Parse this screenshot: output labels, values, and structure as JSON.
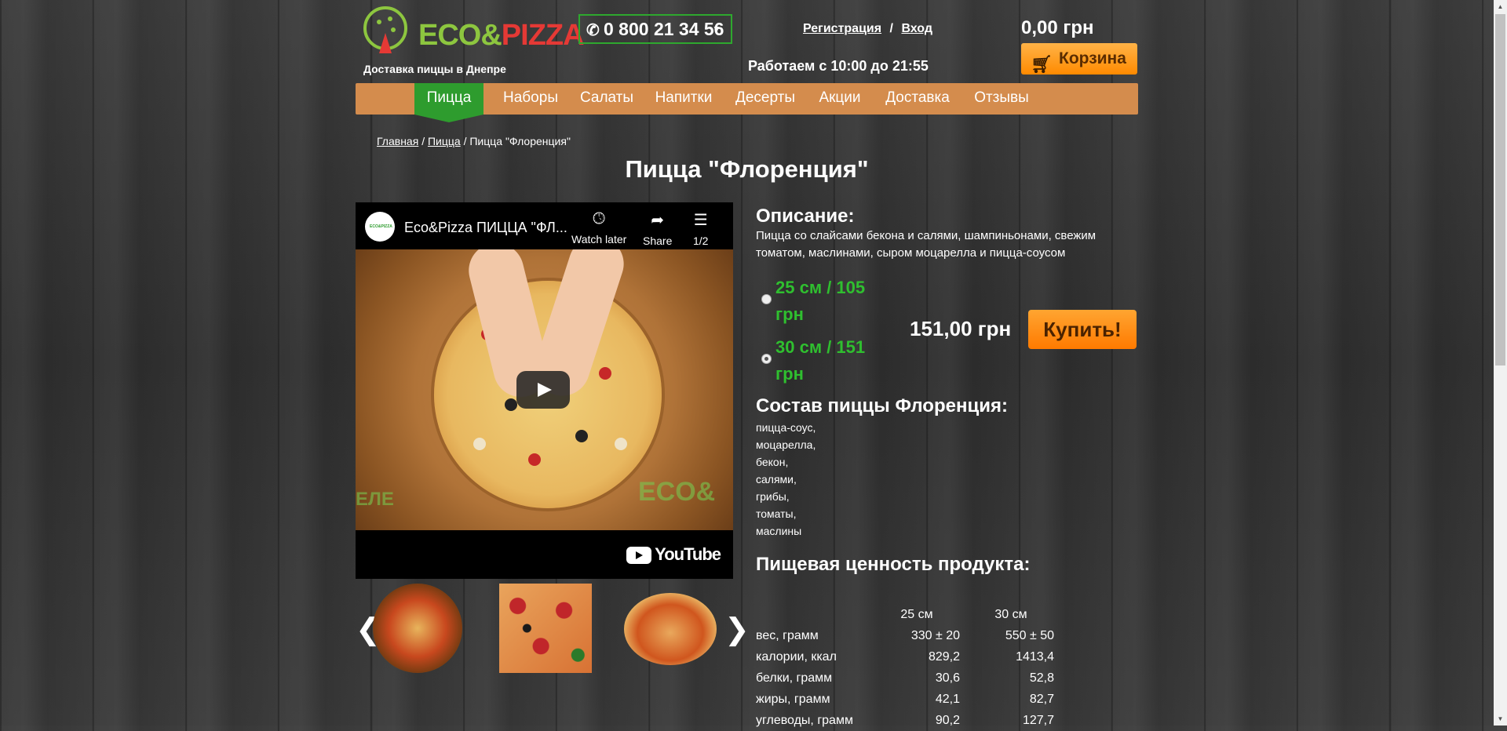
{
  "header": {
    "logo_eco": "ECO&",
    "logo_pizza": "PIZZA",
    "tagline": "Доставка пиццы в Днепре",
    "phone": "0 800 21 34 56",
    "register": "Регистрация",
    "auth_sep": "/",
    "login": "Вход",
    "hours": "Работаем с 10:00 до 21:55",
    "cart_total": "0,00 грн",
    "cart_label": "Корзина"
  },
  "nav": [
    {
      "label": "Пицца",
      "active": true
    },
    {
      "label": "Наборы"
    },
    {
      "label": "Салаты"
    },
    {
      "label": "Напитки"
    },
    {
      "label": "Десерты"
    },
    {
      "label": "Акции"
    },
    {
      "label": "Доставка"
    },
    {
      "label": "Отзывы"
    }
  ],
  "breadcrumb": {
    "home": "Главная",
    "sep": "/",
    "category": "Пицца",
    "current": "Пицца \"Флоренция\""
  },
  "product": {
    "title": "Пицца \"Флоренция\"",
    "desc_heading": "Описание:",
    "description": "Пицца со слайсами бекона и салями, шампиньонами, свежим томатом, маслинами, сыром моцарелла и пицца-соусом",
    "sizes": [
      {
        "line1": "25 см / 105",
        "line2": "грн",
        "selected": false
      },
      {
        "line1": "30 см / 151",
        "line2": "грн",
        "selected": true
      }
    ],
    "price": "151,00 грн",
    "buy_label": "Купить!",
    "composition_heading": "Состав пиццы Флоренция:",
    "composition": [
      "пицца-соус,",
      "моцарелла,",
      "бекон,",
      "салями,",
      "грибы,",
      "томаты,",
      "маслины"
    ],
    "nutrition_heading": "Пищевая ценность продукта:",
    "nutrition": {
      "columns": [
        "",
        "25 см",
        "30 см"
      ],
      "rows": [
        [
          "вес, грамм",
          "330 ± 20",
          "550 ± 50"
        ],
        [
          "калории, ккал",
          "829,2",
          "1413,4"
        ],
        [
          "белки, грамм",
          "30,6",
          "52,8"
        ],
        [
          "жиры, грамм",
          "42,1",
          "82,7"
        ],
        [
          "углеводы, грамм",
          "90,2",
          "127,7"
        ]
      ]
    }
  },
  "video": {
    "title": "Eco&Pizza ПИЦЦА \"ФЛ...",
    "watch_later": "Watch later",
    "share": "Share",
    "playlist": "1/2",
    "watermark": "ECO&",
    "watermark2": "ЕЛЕ",
    "brand": "YouTube",
    "avatar_text": "ECO&PIZZA"
  },
  "gallery": {
    "prev": "❮",
    "next": "❯"
  },
  "colors": {
    "accent_green": "#2e9c2e",
    "nav_bg": "#d48c4d",
    "buy_orange": "#ff8a00",
    "size_green": "#2fbf2f"
  }
}
